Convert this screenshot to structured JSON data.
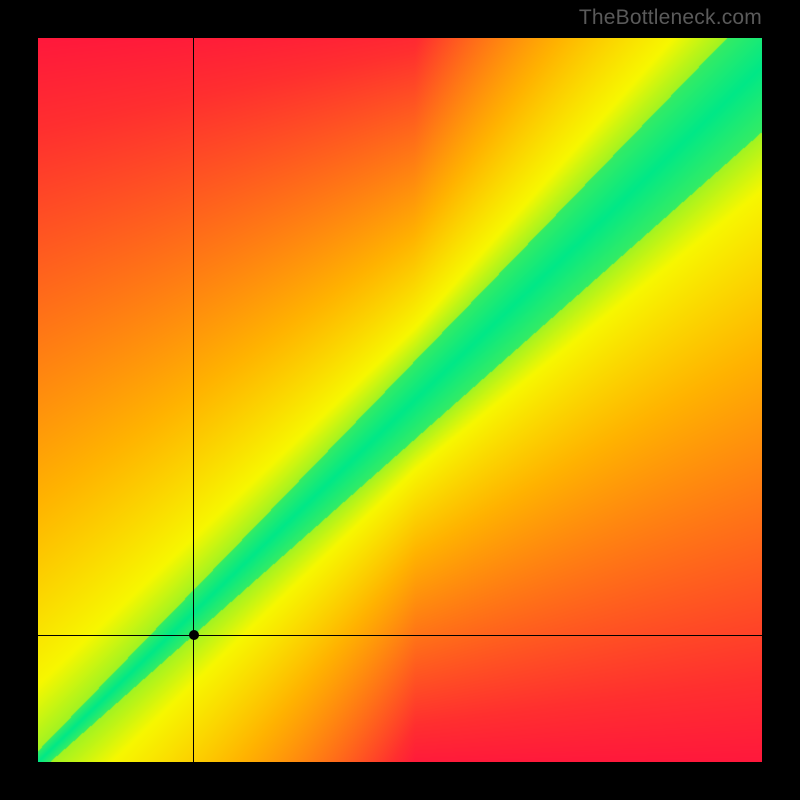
{
  "watermark": "TheBottleneck.com",
  "chart_data": {
    "type": "heatmap",
    "title": "",
    "xlabel": "",
    "ylabel": "",
    "xlim": [
      0,
      1
    ],
    "ylim": [
      0,
      1
    ],
    "colorscale_note": "green = no bottleneck, red = severe bottleneck",
    "marker": {
      "x": 0.215,
      "y": 0.175
    },
    "crosshair": {
      "x": 0.215,
      "y": 0.175
    },
    "optimal_band": {
      "description": "diagonal green band y≈x (slightly below identity), width grows with x",
      "center_line": [
        {
          "x": 0.0,
          "y": 0.0
        },
        {
          "x": 0.1,
          "y": 0.085
        },
        {
          "x": 0.2,
          "y": 0.17
        },
        {
          "x": 0.3,
          "y": 0.26
        },
        {
          "x": 0.4,
          "y": 0.36
        },
        {
          "x": 0.5,
          "y": 0.46
        },
        {
          "x": 0.6,
          "y": 0.56
        },
        {
          "x": 0.7,
          "y": 0.66
        },
        {
          "x": 0.8,
          "y": 0.76
        },
        {
          "x": 0.9,
          "y": 0.86
        },
        {
          "x": 1.0,
          "y": 0.96
        }
      ],
      "half_width_at_x0": 0.015,
      "half_width_at_x1": 0.09
    },
    "color_stops": [
      {
        "score": 0.0,
        "color": "#00e887"
      },
      {
        "score": 0.08,
        "color": "#8cf22a"
      },
      {
        "score": 0.18,
        "color": "#f7f700"
      },
      {
        "score": 0.4,
        "color": "#ffb300"
      },
      {
        "score": 0.65,
        "color": "#ff6a1a"
      },
      {
        "score": 0.85,
        "color": "#ff2f2f"
      },
      {
        "score": 1.0,
        "color": "#ff1040"
      }
    ]
  }
}
